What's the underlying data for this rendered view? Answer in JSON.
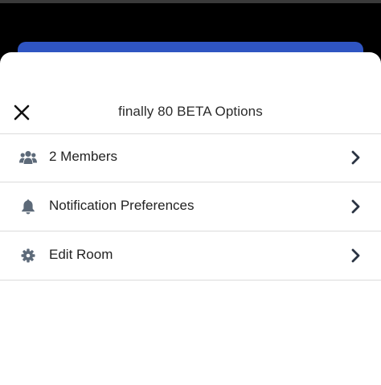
{
  "sheet": {
    "title": "finally 80 BETA Options",
    "close_icon": "close-icon",
    "items": [
      {
        "label": "2 Members",
        "icon": "users-icon"
      },
      {
        "label": "Notification Preferences",
        "icon": "bell-icon"
      },
      {
        "label": "Edit Room",
        "icon": "gear-icon"
      }
    ],
    "chevron_icon": "chevron-right-icon"
  },
  "colors": {
    "backdrop": "#000000",
    "backdrop_button": "#2f55c2",
    "sheet_bg": "#ffffff",
    "icon": "#5d6a79",
    "chevron": "#2a3342",
    "divider": "#dcdcdc"
  }
}
